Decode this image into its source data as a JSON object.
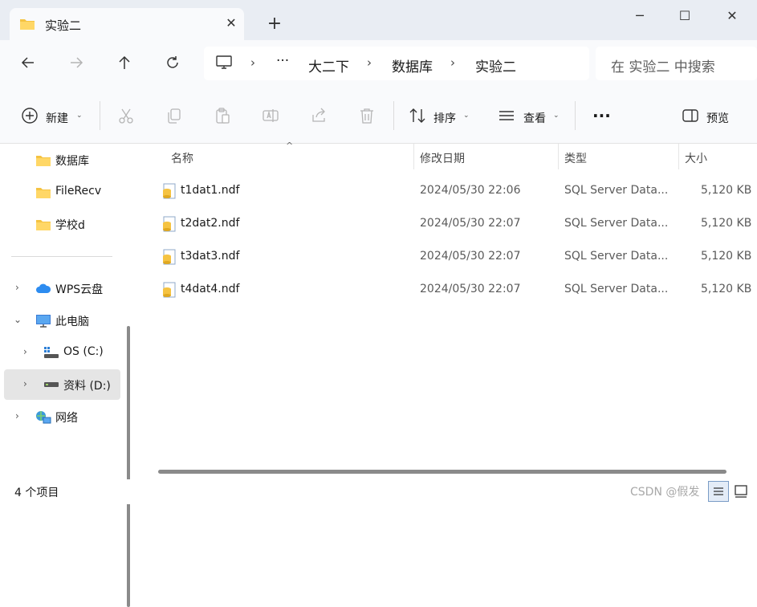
{
  "window": {
    "tab_title": "实验二",
    "tab_close_glyph": "✕",
    "new_tab_glyph": "+",
    "minimize_glyph": "─",
    "maximize_glyph": "☐",
    "close_glyph": "✕"
  },
  "navigation": {
    "breadcrumb": [
      "大二下",
      "数据库",
      "实验二"
    ],
    "ellipsis": "···",
    "search_placeholder": "在 实验二 中搜索"
  },
  "toolbar": {
    "new_label": "新建",
    "sort_label": "排序",
    "view_label": "查看",
    "more_label": "···",
    "preview_label": "预览"
  },
  "nav_pane": {
    "quick_access": [
      "数据库",
      "FileRecv",
      "学校d"
    ],
    "wps_cloud": "WPS云盘",
    "this_pc": "此电脑",
    "drive_c": "OS (C:)",
    "drive_d": "资料 (D:)",
    "network": "网络"
  },
  "columns": {
    "name": "名称",
    "modified": "修改日期",
    "type": "类型",
    "size": "大小"
  },
  "files": [
    {
      "name": "t1dat1.ndf",
      "modified": "2024/05/30 22:06",
      "type": "SQL Server Data...",
      "size": "5,120 KB"
    },
    {
      "name": "t2dat2.ndf",
      "modified": "2024/05/30 22:07",
      "type": "SQL Server Data...",
      "size": "5,120 KB"
    },
    {
      "name": "t3dat3.ndf",
      "modified": "2024/05/30 22:07",
      "type": "SQL Server Data...",
      "size": "5,120 KB"
    },
    {
      "name": "t4dat4.ndf",
      "modified": "2024/05/30 22:07",
      "type": "SQL Server Data...",
      "size": "5,120 KB"
    }
  ],
  "status": {
    "item_count": "4 个项目",
    "watermark": "CSDN @假发"
  },
  "colors": {
    "folder": "#f5c342",
    "titlebar_bg": "#e9edf3",
    "selected_bg": "#e5e5e5"
  }
}
